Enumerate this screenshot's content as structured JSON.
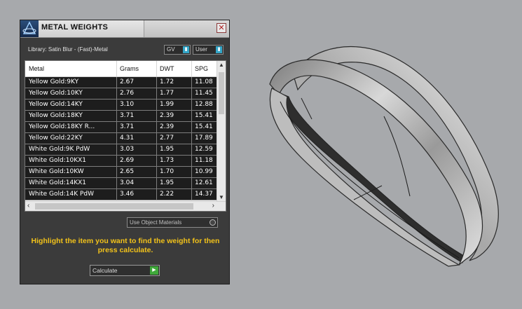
{
  "panel": {
    "title": "METAL WEIGHTS",
    "close_glyph": "✕",
    "library_label": "Library: Satin Blur - (Fast)-Metal",
    "dropdown_gv": "GV",
    "dropdown_user": "User",
    "use_object_materials": "Use Object Materials",
    "instruction": "Highlight the item you want to find the weight for then press calculate.",
    "calculate_label": "Calculate"
  },
  "table": {
    "headers": {
      "metal": "Metal",
      "grams": "Grams",
      "dwt": "DWT",
      "spg": "SPG"
    },
    "rows": [
      {
        "metal": "Yellow Gold:9KY",
        "grams": "2.67",
        "dwt": "1.72",
        "spg": "11.08"
      },
      {
        "metal": "Yellow Gold:10KY",
        "grams": "2.76",
        "dwt": "1.77",
        "spg": "11.45"
      },
      {
        "metal": "Yellow Gold:14KY",
        "grams": "3.10",
        "dwt": "1.99",
        "spg": "12.88"
      },
      {
        "metal": "Yellow Gold:18KY",
        "grams": "3.71",
        "dwt": "2.39",
        "spg": "15.41"
      },
      {
        "metal": "Yellow Gold:18KY R...",
        "grams": "3.71",
        "dwt": "2.39",
        "spg": "15.41"
      },
      {
        "metal": "Yellow Gold:22KY",
        "grams": "4.31",
        "dwt": "2.77",
        "spg": "17.89"
      },
      {
        "metal": "White Gold:9K PdW",
        "grams": "3.03",
        "dwt": "1.95",
        "spg": "12.59"
      },
      {
        "metal": "White Gold:10KX1",
        "grams": "2.69",
        "dwt": "1.73",
        "spg": "11.18"
      },
      {
        "metal": "White Gold:10KW",
        "grams": "2.65",
        "dwt": "1.70",
        "spg": "10.99"
      },
      {
        "metal": "White Gold:14KX1",
        "grams": "3.04",
        "dwt": "1.95",
        "spg": "12.61"
      },
      {
        "metal": "White Gold:14K PdW",
        "grams": "3.46",
        "dwt": "2.22",
        "spg": "14.37"
      }
    ]
  },
  "icons": {
    "logo": "app-logo-icon",
    "close": "close-icon",
    "dropdown": "dropdown-arrow-icon",
    "calculate": "play-arrow-icon"
  },
  "colors": {
    "panel_bg": "#3b3b3b",
    "row_bg": "#1d1d1d",
    "instruction": "#f2c21a",
    "accent_blue": "#34a6c8",
    "go_green": "#3fa83a",
    "viewport_bg": "#a7a9ac"
  }
}
